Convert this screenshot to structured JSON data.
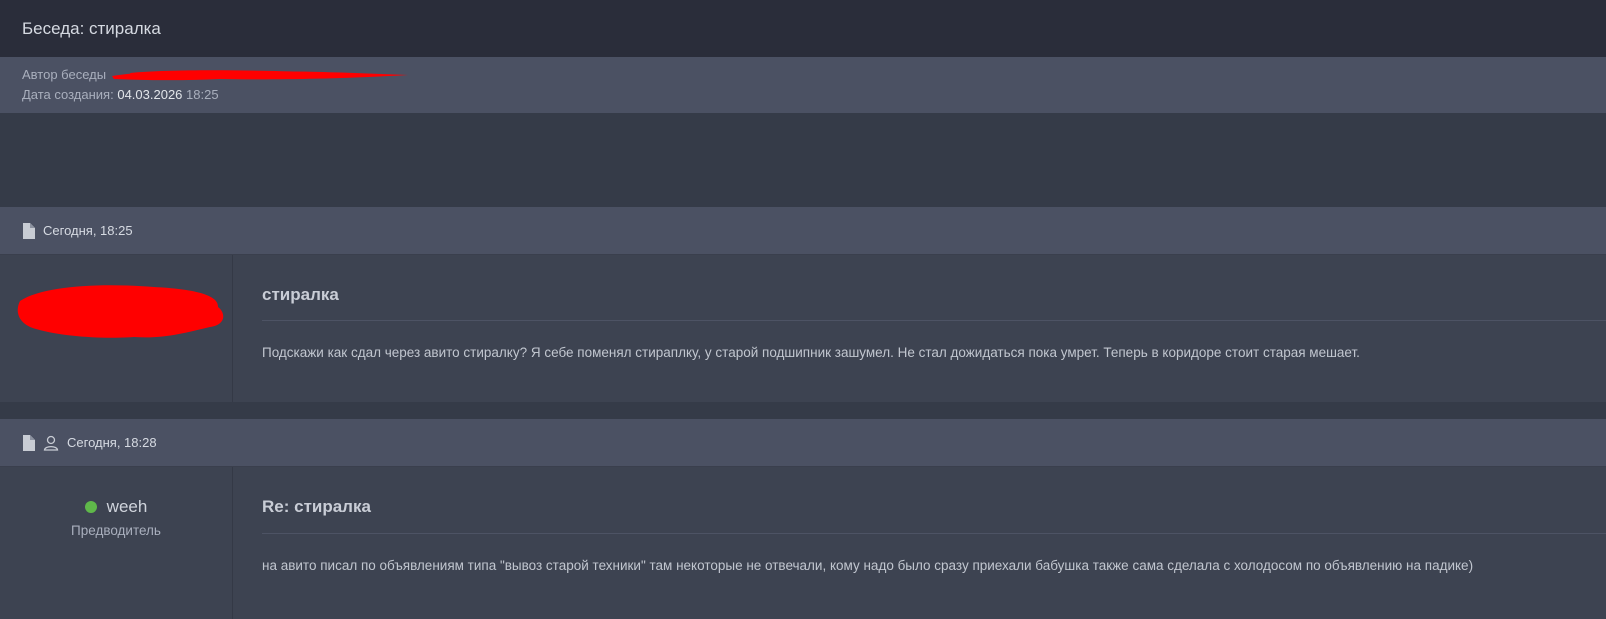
{
  "header": {
    "title": "Беседа: стиралка"
  },
  "meta": {
    "author_label": "Автор беседы",
    "date_label": "Дата создания:",
    "date_value": "04.03.2026",
    "time_value": "18:25"
  },
  "posts": [
    {
      "timestamp": "Сегодня, 18:25",
      "title": "стиралка",
      "text": "Подскажи как сдал через авито стиралку? Я себе поменял стираплку, у старой подшипник зашумел. Не стал дожидаться пока умрет. Теперь в коридоре стоит старая мешает."
    },
    {
      "timestamp": "Сегодня, 18:28",
      "author": "weeh",
      "rank": "Предводитель",
      "title": "Re: стиралка",
      "text": "на авито писал по объявлениям типа \"вывоз старой техники\" там некоторые не отвечали, кому надо было сразу приехали бабушка также сама сделала с холодосом по объявлению на падике)"
    }
  ],
  "colors": {
    "accent_online": "#5fb84a",
    "redaction": "#ff0000"
  }
}
